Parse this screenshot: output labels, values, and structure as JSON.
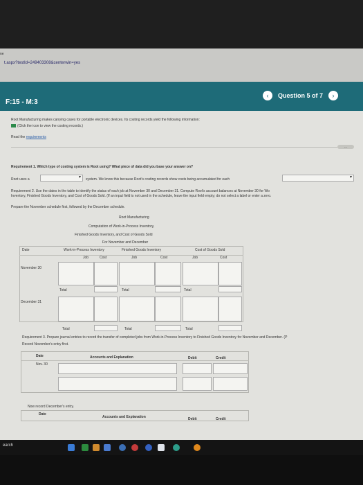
{
  "browser": {
    "url": "t.aspx?testId=249403308&centerwin=yes",
    "corner": "ne"
  },
  "header": {
    "title": "F:15 - M:3",
    "question": "Question 5 of 7",
    "prev": "‹",
    "next": "›"
  },
  "intro": {
    "line1": "Root Manufacturing makes carrying cases for portable electronic devices. Its costing records yield the following information:",
    "icon_link": "(Click the icon to view the costing records.)",
    "read": "Read the ",
    "requirements": "requirements"
  },
  "req1": {
    "q": "Requirement 1. Which type of costing system is Root using? What piece of data did you base your answer on?",
    "prefix": "Root uses a",
    "mid": "system. We know this because Root's costing records show costs being accumulated for each"
  },
  "req2": {
    "line1": "Requirement 2. Use the dates in the table to identify the status of each job at November 30 and December 31. Compute Root's account balances at November 30 for Wo",
    "line2": "Inventory, Finished Goods Inventory, and Cost of Goods Sold. (If an input field is not used in the schedule, leave the input field empty; do not select a label or enter a zero.",
    "prepare": "Prepare the November schedule first, followed by the December schedule."
  },
  "schedule": {
    "t1": "Root Manufacturing",
    "t2": "Computation of Work-in-Process Inventory,",
    "t3": "Finished Goods Inventory, and Cost of Goods Sold",
    "t4": "For November and December",
    "date": "Date",
    "wip": "Work-in-Process Inventory",
    "fg": "Finished Goods Inventory",
    "cogs": "Cost of Goods Sold",
    "job": "Job",
    "cost": "Cost",
    "nov": "November 30",
    "dec": "December 31",
    "total": "Total"
  },
  "req3": {
    "line1": "Requirement 3. Prepare journal entries to record the transfer of completed jobs from Work-in-Process Inventory to Finished Goods Inventory for November and December. (P",
    "line2": "Record November's entry first.",
    "date": "Date",
    "acct": "Accounts and Explanation",
    "debit": "Debit",
    "credit": "Credit",
    "nov": "Nov. 30",
    "next": "Now record December's entry.",
    "date2": "Date",
    "acct2": "Accounts and Explanation",
    "debit2": "Debit",
    "credit2": "Credit"
  },
  "taskbar": {
    "search": "earch"
  },
  "colors": {
    "header": "#1e6b78",
    "link": "#2b5ea8"
  }
}
